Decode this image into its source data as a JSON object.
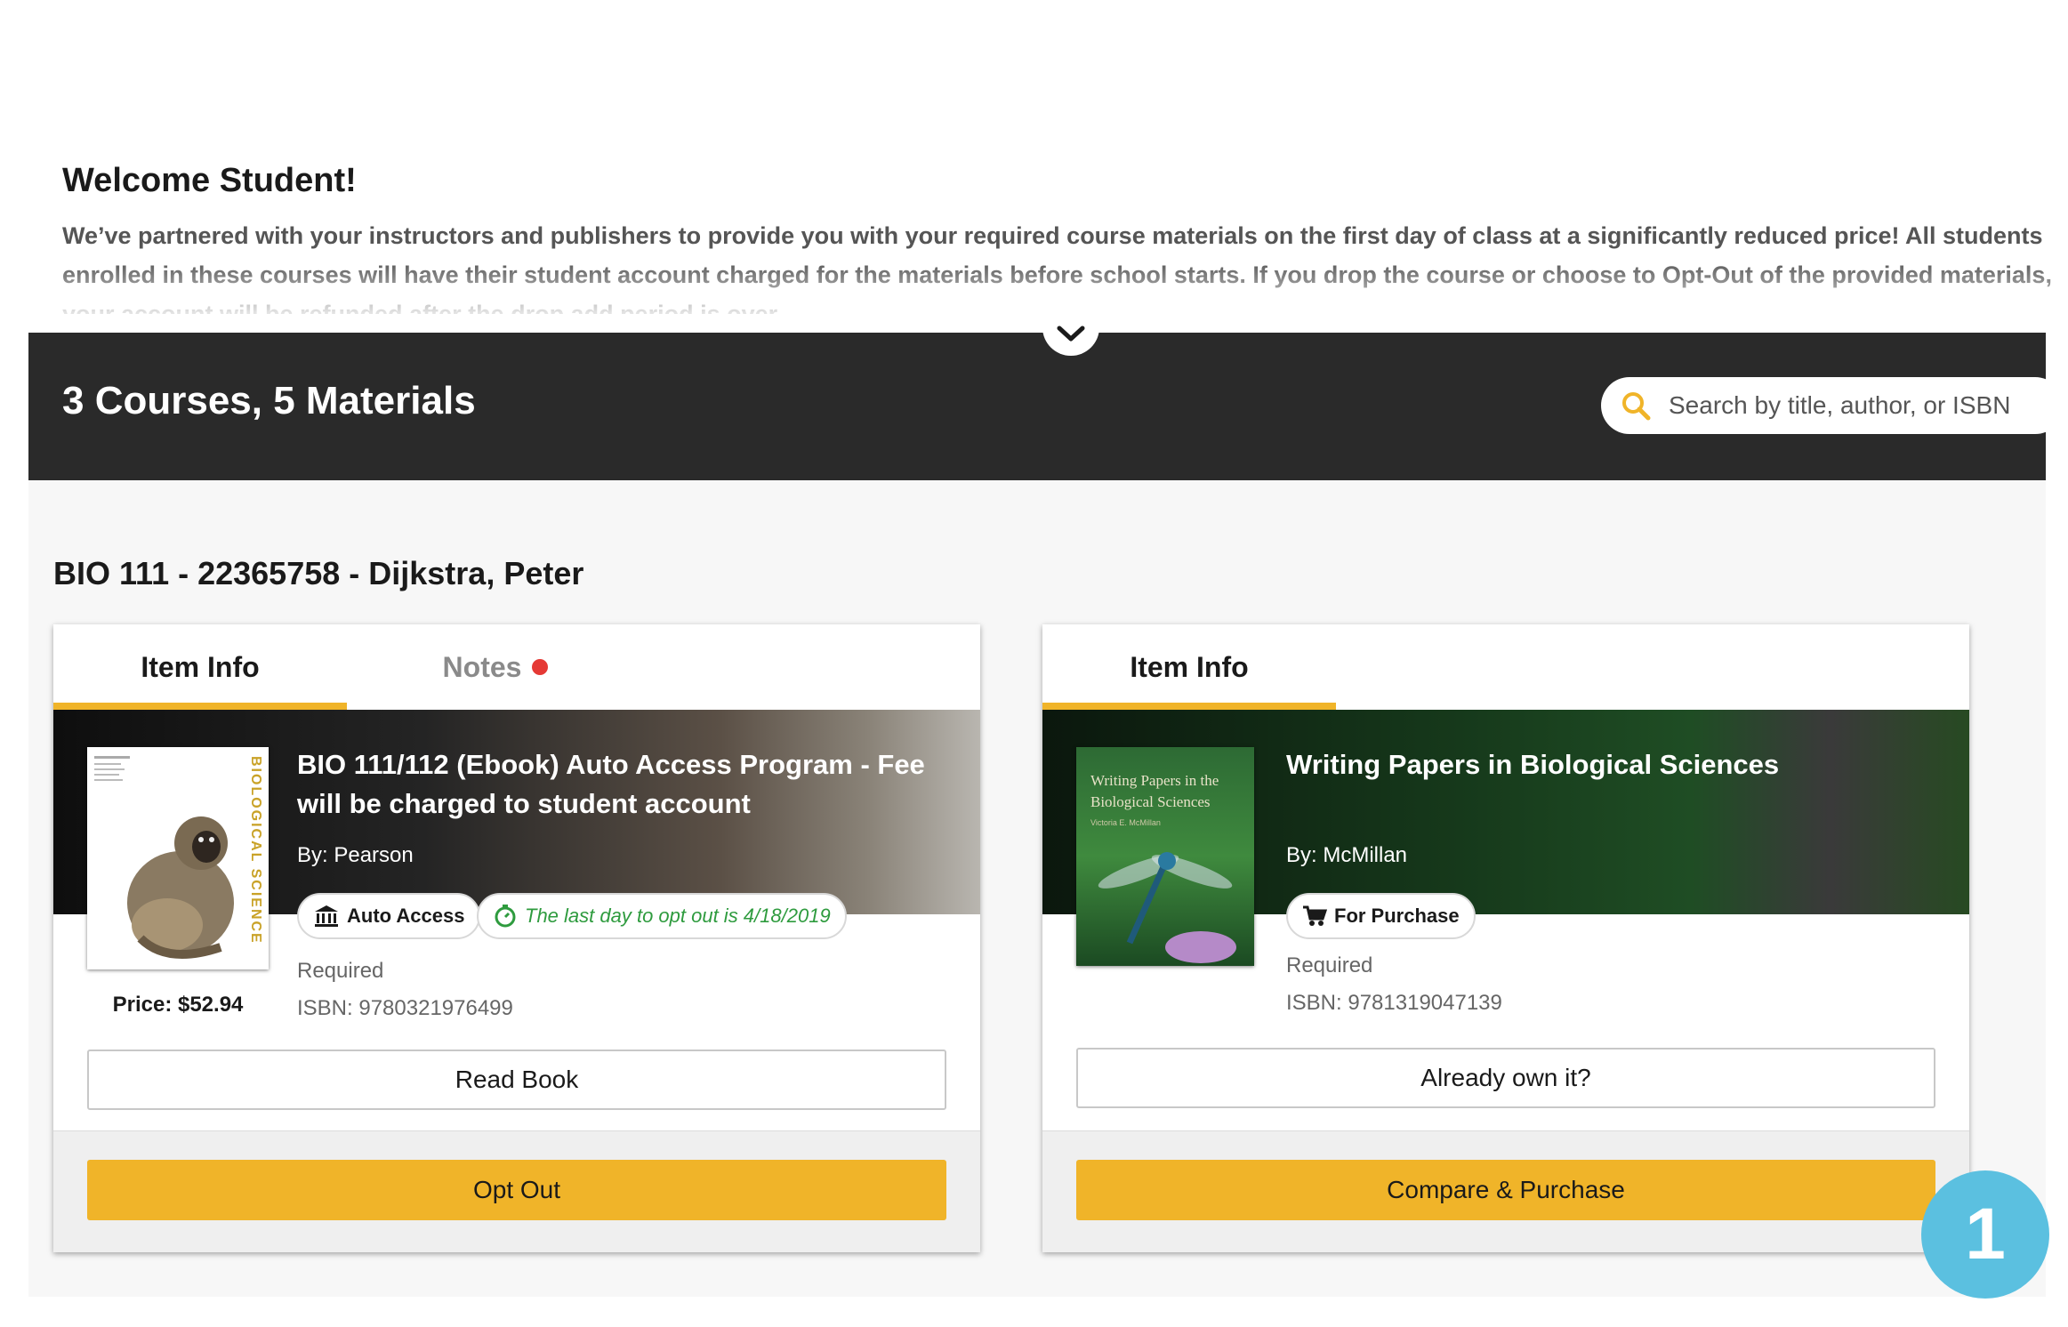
{
  "welcome": {
    "title": "Welcome Student!",
    "text": "We’ve partnered with your instructors and publishers to provide you with your required course materials on the first day of class at a significantly reduced price! All students enrolled in these courses will have their student account charged for the materials before school starts. If you drop the course or choose to Opt-Out of the provided materials, your account will be refunded after the drop add period is over."
  },
  "banner": {
    "summary": "3 Courses, 5 Materials",
    "search_placeholder": "Search by title, author, or ISBN"
  },
  "course": {
    "title": "BIO 111 - 22365758 - Dijkstra, Peter"
  },
  "cards": [
    {
      "tabs": [
        {
          "label": "Item Info",
          "active": true
        },
        {
          "label": "Notes",
          "active": false,
          "has_notification": true
        }
      ],
      "book_title": "BIO 111/112 (Ebook) Auto Access Program - Fee will be charged to student account",
      "by": "By: Pearson",
      "badge": "Auto Access",
      "deadline": "The last day to opt out is 4/18/2019",
      "requirement": "Required",
      "isbn": "ISBN:  9780321976499",
      "price": "Price: $52.94",
      "cover_spine": "BIOLOGICAL SCIENCE",
      "secondary_button": "Read Book",
      "primary_button": "Opt Out"
    },
    {
      "tabs": [
        {
          "label": "Item Info",
          "active": true
        }
      ],
      "book_title": "Writing Papers in Biological Sciences",
      "by": "By: McMillan",
      "badge": "For Purchase",
      "requirement": "Required",
      "isbn": "ISBN:  9781319047139",
      "cover_title": "Writing Papers in the Biological Sciences",
      "cover_author": "Victoria E. McMillan",
      "secondary_button": "Already own it?",
      "primary_button": "Compare & Purchase"
    }
  ],
  "step_marker": "1",
  "colors": {
    "accent": "#f0b429",
    "banner_bg": "#2a2a2a",
    "notification": "#e53935",
    "deadline_text": "#2e9b3e",
    "step_marker": "#5bc0e0"
  }
}
